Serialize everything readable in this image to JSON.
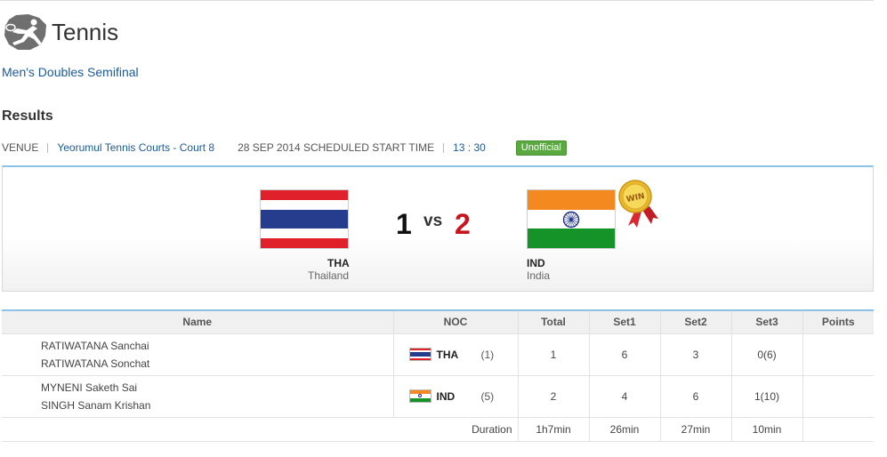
{
  "sport": {
    "title": "Tennis",
    "icon": "tennis-player-icon"
  },
  "event": {
    "name": "Men's Doubles Semifinal"
  },
  "results_heading": "Results",
  "info": {
    "venue_label": "VENUE",
    "venue": "Yeorumul Tennis Courts - Court 8",
    "date_label": "28 SEP 2014 SCHEDULED START TIME",
    "time": "13 : 30",
    "status": "Unofficial"
  },
  "colors": {
    "link": "#1a5a9a",
    "status_badge": "#5aa940",
    "winner_score": "#c8141e",
    "accent_line": "#8ec1e8"
  },
  "match": {
    "left": {
      "code": "THA",
      "name": "Thailand",
      "score": "1",
      "flag": "thailand-flag"
    },
    "right": {
      "code": "IND",
      "name": "India",
      "score": "2",
      "flag": "india-flag",
      "badge": "WIN"
    },
    "vs": "vs"
  },
  "table": {
    "headers": [
      "Name",
      "NOC",
      "Total",
      "Set1",
      "Set2",
      "Set3",
      "Points"
    ],
    "rows": [
      {
        "players": [
          "RATIWATANA Sanchai",
          "RATIWATANA Sonchat"
        ],
        "noc": "THA",
        "seed": "(1)",
        "total": "1",
        "set1": "6",
        "set2": "3",
        "set3": "0(6)",
        "points": ""
      },
      {
        "players": [
          "MYNENI Saketh Sai",
          "SINGH Sanam Krishan"
        ],
        "noc": "IND",
        "seed": "(5)",
        "total": "2",
        "set1": "4",
        "set2": "6",
        "set3": "1(10)",
        "points": ""
      }
    ],
    "duration": {
      "label": "Duration",
      "total": "1h7min",
      "set1": "26min",
      "set2": "27min",
      "set3": "10min"
    }
  }
}
